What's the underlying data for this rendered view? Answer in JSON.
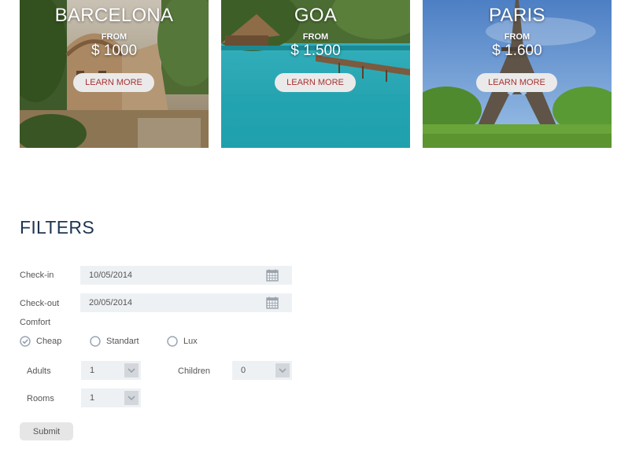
{
  "destinations": [
    {
      "city": "BARCELONA",
      "from_label": "FROM",
      "price": "$ 1000",
      "button": "LEARN MORE"
    },
    {
      "city": "GOA",
      "from_label": "FROM",
      "price": "$ 1.500",
      "button": "LEARN MORE"
    },
    {
      "city": "PARIS",
      "from_label": "FROM",
      "price": "$ 1.600",
      "button": "LEARN MORE"
    }
  ],
  "filters": {
    "title": "FILTERS",
    "checkin": {
      "label": "Check-in",
      "value": "10/05/2014",
      "icon": "calendar-icon"
    },
    "checkout": {
      "label": "Check-out",
      "value": "20/05/2014",
      "icon": "calendar-icon"
    },
    "comfort": {
      "label": "Comfort",
      "options": [
        "Cheap",
        "Standart",
        "Lux"
      ],
      "selected": "Cheap"
    },
    "adults": {
      "label": "Adults",
      "value": "1"
    },
    "children": {
      "label": "Children",
      "value": "0"
    },
    "rooms": {
      "label": "Rooms",
      "value": "1"
    },
    "submit": "Submit"
  },
  "colors": {
    "title": "#1f3550",
    "learn_more_text": "#a83232",
    "field_bg": "#eef1f4",
    "radio_checked": "#9aa7b5"
  }
}
